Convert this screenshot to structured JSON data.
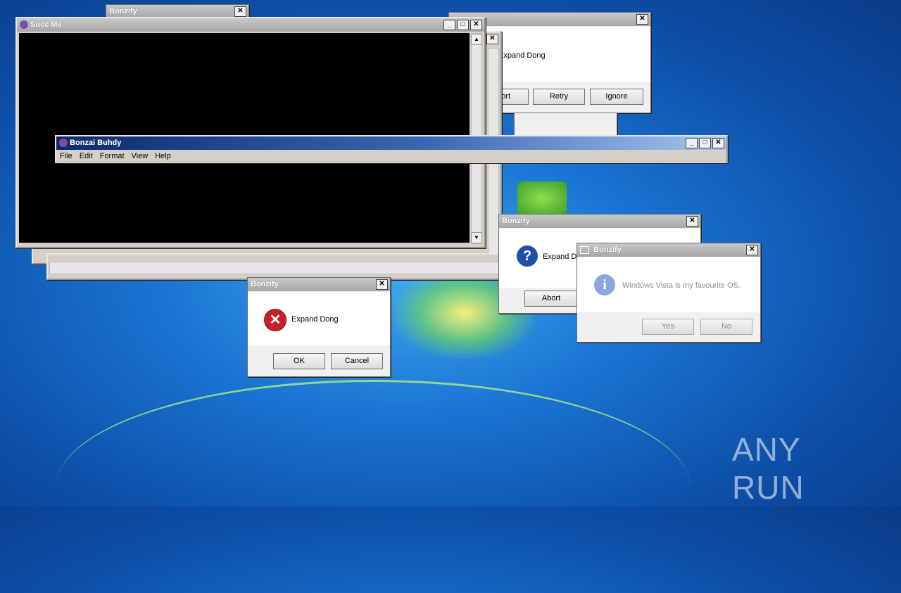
{
  "watermark": {
    "text": "ANY RUN"
  },
  "windows": {
    "top_stub": {
      "title": "Bonzify"
    },
    "retry_dialog": {
      "message": "Expand Dong",
      "abort_label": "Abort",
      "retry_label": "Retry",
      "ignore_label": "Ignore"
    },
    "succ_me": {
      "title": "Succ Me"
    },
    "bonzai": {
      "title": "Bonzai Buhdy",
      "menu": [
        "File",
        "Edit",
        "Format",
        "View",
        "Help"
      ]
    },
    "question_dialog": {
      "title": "Bonzify",
      "message": "Expand Dong",
      "abort_label": "Abort"
    },
    "vista_dialog": {
      "title": "Bonzify",
      "message": "Windows Vista is my favourite OS.",
      "yes_label": "Yes",
      "no_label": "No"
    },
    "error_dialog": {
      "title": "Bonzify",
      "message": "Expand Dong",
      "ok_label": "OK",
      "cancel_label": "Cancel"
    }
  },
  "colors": {
    "error": "#c8202a",
    "question": "#1f4fa8",
    "info": "#8aa6dc"
  }
}
